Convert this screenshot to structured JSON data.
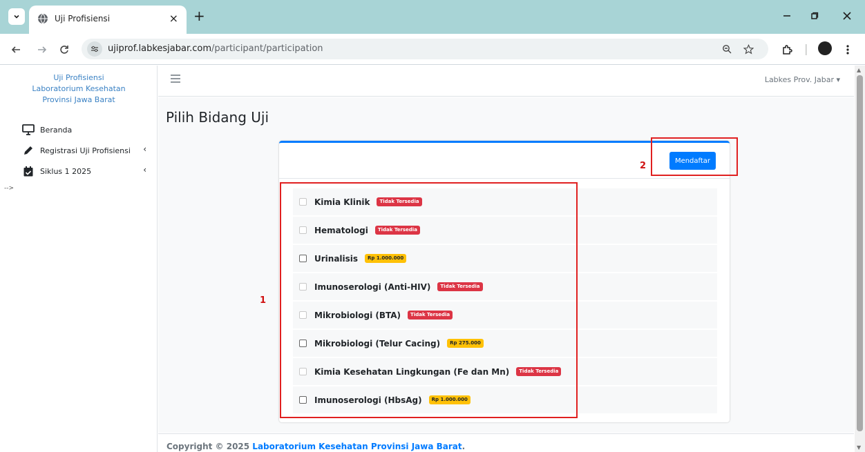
{
  "browser": {
    "tab_title": "Uji Profisiensi",
    "tab_close": "×",
    "new_tab": "+",
    "url_host": "ujiprof.labkesjabar.com",
    "url_path": "/participant/participation"
  },
  "sidebar": {
    "brand_line1": "Uji Profisiensi",
    "brand_line2": "Laboratorium Kesehatan",
    "brand_line3": "Provinsi Jawa Barat",
    "items": [
      {
        "label": "Beranda",
        "icon": "desktop-icon"
      },
      {
        "label": "Registrasi Uji Profisiensi",
        "icon": "pencil-icon",
        "chevron": "‹"
      },
      {
        "label": "Siklus 1 2025",
        "icon": "calendar-check-icon",
        "chevron": "‹"
      }
    ],
    "stray_text": "-->"
  },
  "topnav": {
    "user": "Labkes Prov. Jabar ▾"
  },
  "page": {
    "title": "Pilih Bidang Uji",
    "register_button": "Mendaftar",
    "items": [
      {
        "label": "Kimia Klinik",
        "badge": "Tidak Tersedia",
        "status": "danger",
        "enabled": false
      },
      {
        "label": "Hematologi",
        "badge": "Tidak Tersedia",
        "status": "danger",
        "enabled": false
      },
      {
        "label": "Urinalisis",
        "badge": "Rp 1.000.000",
        "status": "warning",
        "enabled": true
      },
      {
        "label": "Imunoserologi (Anti-HIV)",
        "badge": "Tidak Tersedia",
        "status": "danger",
        "enabled": false
      },
      {
        "label": "Mikrobiologi (BTA)",
        "badge": "Tidak Tersedia",
        "status": "danger",
        "enabled": false
      },
      {
        "label": "Mikrobiologi (Telur Cacing)",
        "badge": "Rp 275.000",
        "status": "warning",
        "enabled": true
      },
      {
        "label": "Kimia Kesehatan Lingkungan (Fe dan Mn)",
        "badge": "Tidak Tersedia",
        "status": "danger",
        "enabled": false
      },
      {
        "label": "Imunoserologi (HbsAg)",
        "badge": "Rp 1.000.000",
        "status": "warning",
        "enabled": true
      }
    ]
  },
  "annotations": {
    "label1": "1",
    "label2": "2"
  },
  "footer": {
    "prefix": "Copyright © 2025 ",
    "link": "Laboratorium Kesehatan Provinsi Jawa Barat",
    "suffix": "."
  },
  "colors": {
    "tabbar": "#a8d4d6",
    "primary": "#007bff",
    "danger": "#dc3545",
    "warning": "#ffc107",
    "annotation": "#e02020"
  }
}
